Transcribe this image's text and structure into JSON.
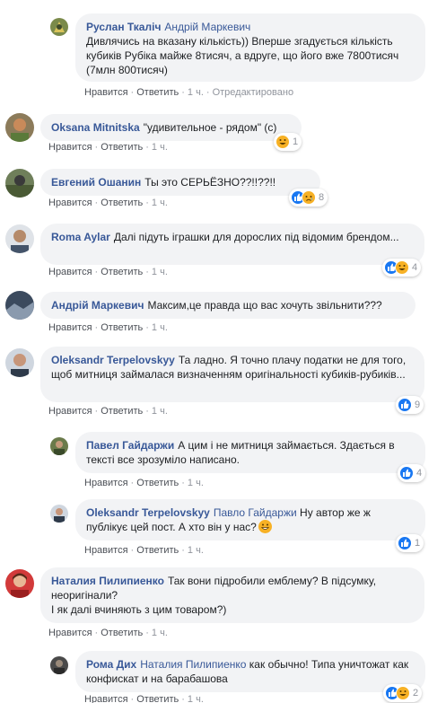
{
  "comments": [
    {
      "author": "Руслан Ткаліч",
      "mention": "Андрій Маркевич",
      "text": "Дивлячись на вказану кількість)) Вперше згадується кількість кубиків Рубіка майже 8тисяч, а вдруге, що його вже 7800тисяч (7млн 800тисяч)",
      "actions": {
        "like": "Нравится",
        "reply": "Ответить",
        "time": "1 ч.",
        "edited": "Отредактировано"
      }
    },
    {
      "author": "Oksana Mitnitska",
      "text": "\"удивительное - рядом\" (с)",
      "reactions": {
        "icons": [
          "haha-icon"
        ],
        "count": "1"
      },
      "actions": {
        "like": "Нравится",
        "reply": "Ответить",
        "time": "1 ч."
      }
    },
    {
      "author": "Евгений Ошанин",
      "text": "Ты это СЕРЬЁЗНО??!!??!!",
      "reactions": {
        "icons": [
          "like-icon",
          "sad-icon"
        ],
        "count": "8"
      },
      "actions": {
        "like": "Нравится",
        "reply": "Ответить",
        "time": "1 ч."
      }
    },
    {
      "author": "Roma Aylar",
      "text": "Далі підуть іграшки для дорослих під відомим брендом...",
      "reactions": {
        "icons": [
          "like-icon",
          "haha-icon"
        ],
        "count": "4"
      },
      "actions": {
        "like": "Нравится",
        "reply": "Ответить",
        "time": "1 ч."
      }
    },
    {
      "author": "Андрій Маркевич",
      "text": "Максим,це правда що вас хочуть звільнити???",
      "actions": {
        "like": "Нравится",
        "reply": "Ответить",
        "time": "1 ч."
      }
    },
    {
      "author": "Oleksandr Terpelovskyy",
      "text": "Та ладно. Я точно плачу податки не для того, щоб митниця займалася визначенням оригінальності кубиків-рубиків...",
      "reactions": {
        "icons": [
          "like-icon"
        ],
        "count": "9"
      },
      "actions": {
        "like": "Нравится",
        "reply": "Ответить",
        "time": "1 ч."
      }
    },
    {
      "author": "Павел Гайдаржи",
      "text": "А цим і не митниця займається. Здається в тексті все зрозуміло написано.",
      "reactions": {
        "icons": [
          "like-icon"
        ],
        "count": "4"
      },
      "actions": {
        "like": "Нравится",
        "reply": "Ответить",
        "time": "1 ч."
      }
    },
    {
      "author": "Oleksandr Terpelovskyy",
      "mention": "Павло Гайдаржи",
      "text": "Ну автор же ж публікує цей пост. А хто він у нас?",
      "reactions": {
        "icons": [
          "like-icon"
        ],
        "count": "1"
      },
      "actions": {
        "like": "Нравится",
        "reply": "Ответить",
        "time": "1 ч."
      }
    },
    {
      "author": "Наталия Пилипиенко",
      "text": "Так вони підробили емблему? В підсумку, неоригінали?\nІ як далі вчиняють з цим товаром?)",
      "actions": {
        "like": "Нравится",
        "reply": "Ответить",
        "time": "1 ч."
      }
    },
    {
      "author": "Рома Дих",
      "mention": "Наталия Пилипиенко",
      "text": "как обычно! Типа уничтожат как конфискат и на барабашова",
      "reactions": {
        "icons": [
          "like-icon",
          "haha-icon"
        ],
        "count": "2"
      },
      "actions": {
        "like": "Нравится",
        "reply": "Ответить",
        "time": "1 ч."
      }
    }
  ],
  "colors": {
    "link": "#385898",
    "bubble": "#f2f3f5",
    "meta": "#90949c",
    "like": "#1877f2",
    "emoji": "#f7b125"
  }
}
